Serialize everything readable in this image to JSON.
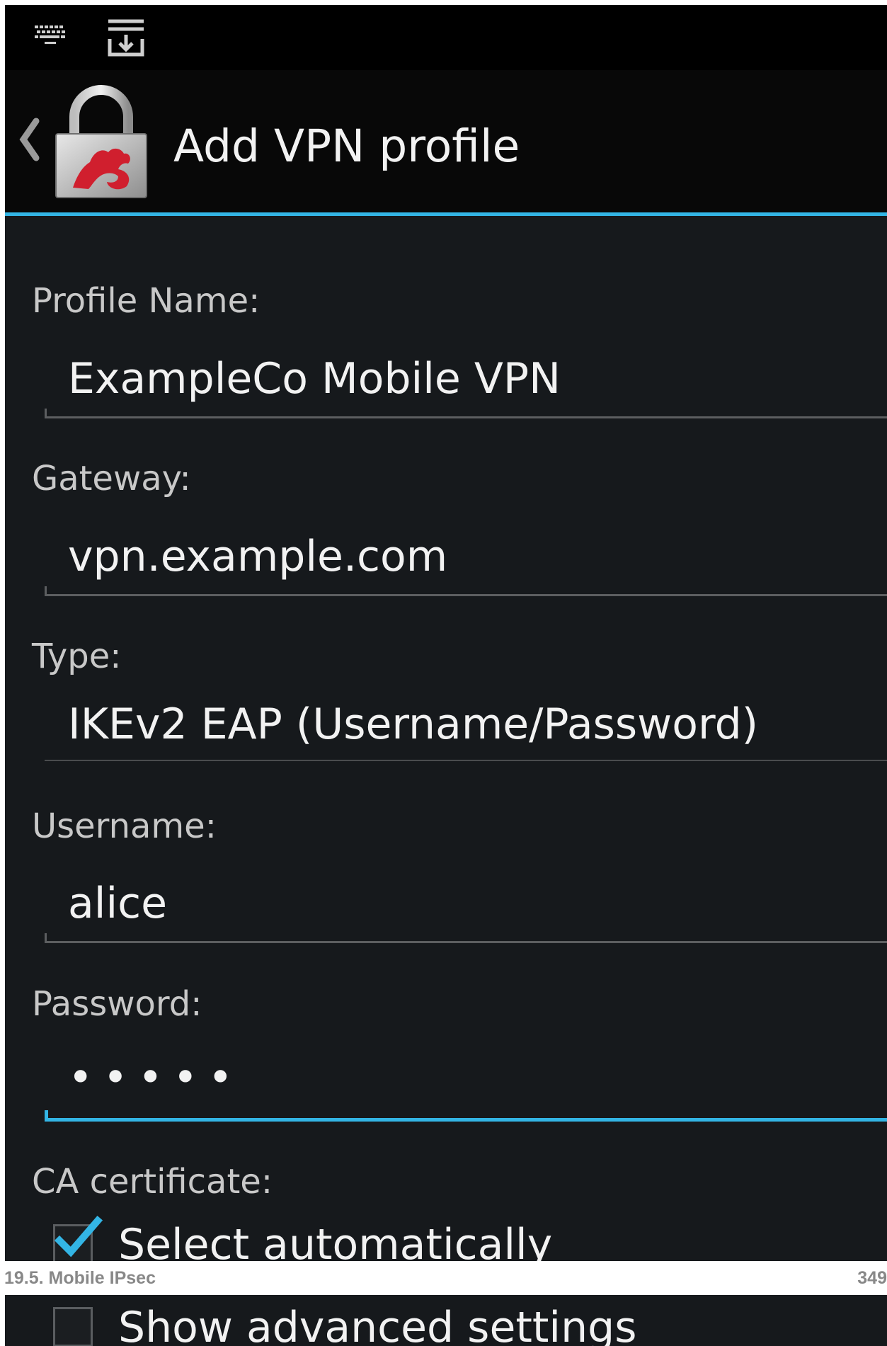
{
  "title": "Add VPN profile",
  "accent_color": "#33b5e5",
  "status_icons": [
    "keyboard-icon",
    "download-icon"
  ],
  "form": {
    "profile_name_label": "Profile Name:",
    "profile_name_value": "ExampleCo Mobile VPN",
    "gateway_label": "Gateway:",
    "gateway_value": "vpn.example.com",
    "type_label": "Type:",
    "type_value": "IKEv2 EAP (Username/Password)",
    "username_label": "Username:",
    "username_value": "alice",
    "password_label": "Password:",
    "password_value": "•••••",
    "ca_label": "CA certificate:",
    "select_auto_label": "Select automatically",
    "select_auto_checked": true,
    "advanced_label": "Show advanced settings",
    "advanced_checked": false
  },
  "footer": {
    "section": "19.5. Mobile IPsec",
    "page": "349"
  }
}
